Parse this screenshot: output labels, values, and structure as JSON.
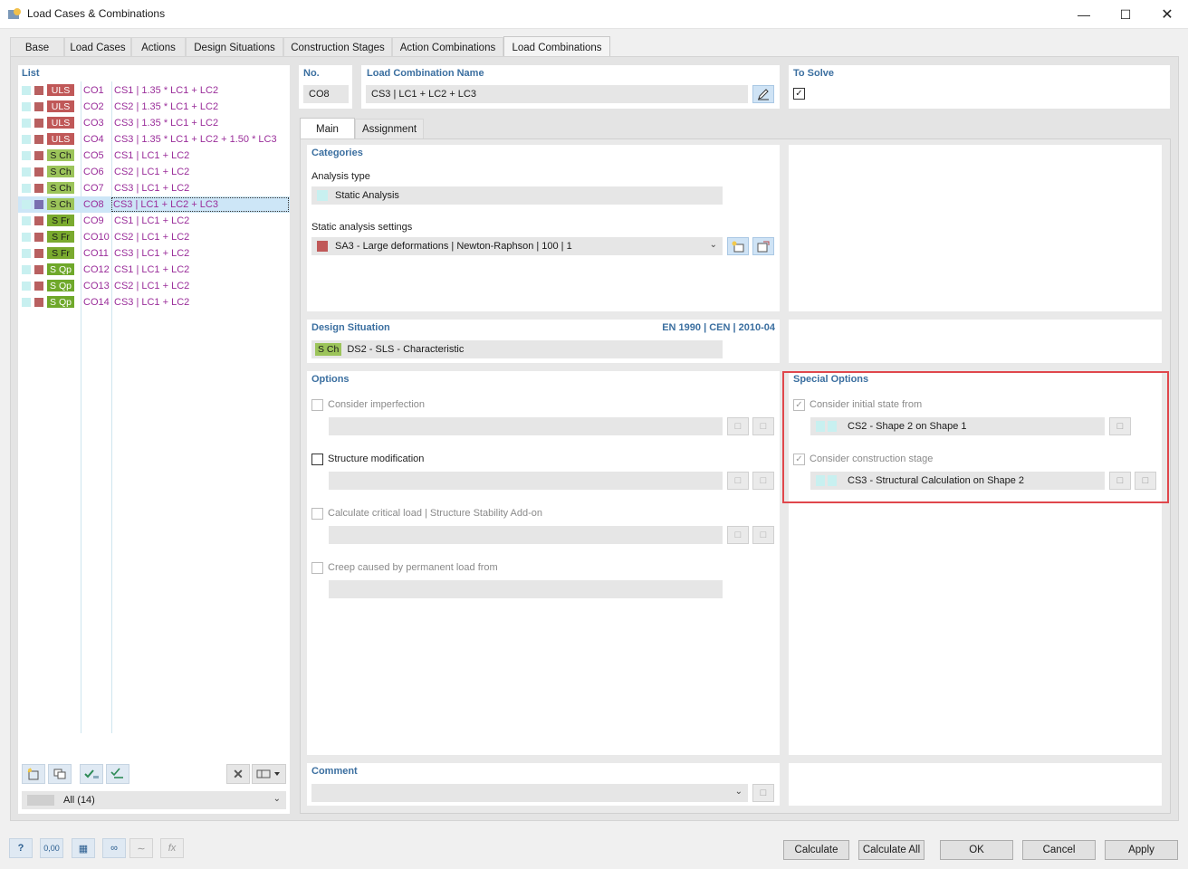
{
  "window": {
    "title": "Load Cases & Combinations"
  },
  "tabs": [
    "Base",
    "Load Cases",
    "Actions",
    "Design Situations",
    "Construction Stages",
    "Action Combinations",
    "Load Combinations"
  ],
  "list": {
    "header": "List",
    "filter": "All (14)",
    "items": [
      {
        "badge": "ULS",
        "code": "CO1",
        "desc": "CS1 | 1.35 * LC1 + LC2"
      },
      {
        "badge": "ULS",
        "code": "CO2",
        "desc": "CS2 | 1.35 * LC1 + LC2"
      },
      {
        "badge": "ULS",
        "code": "CO3",
        "desc": "CS3 | 1.35 * LC1 + LC2"
      },
      {
        "badge": "ULS",
        "code": "CO4",
        "desc": "CS3 | 1.35 * LC1 + LC2 + 1.50 * LC3"
      },
      {
        "badge": "S Ch",
        "code": "CO5",
        "desc": "CS1 | LC1 + LC2"
      },
      {
        "badge": "S Ch",
        "code": "CO6",
        "desc": "CS2 | LC1 + LC2"
      },
      {
        "badge": "S Ch",
        "code": "CO7",
        "desc": "CS3 | LC1 + LC2"
      },
      {
        "badge": "S Ch",
        "code": "CO8",
        "desc": "CS3 | LC1 + LC2 + LC3"
      },
      {
        "badge": "S Fr",
        "code": "CO9",
        "desc": "CS1 | LC1 + LC2"
      },
      {
        "badge": "S Fr",
        "code": "CO10",
        "desc": "CS2 | LC1 + LC2"
      },
      {
        "badge": "S Fr",
        "code": "CO11",
        "desc": "CS3 | LC1 + LC2"
      },
      {
        "badge": "S Qp",
        "code": "CO12",
        "desc": "CS1 | LC1 + LC2"
      },
      {
        "badge": "S Qp",
        "code": "CO13",
        "desc": "CS2 | LC1 + LC2"
      },
      {
        "badge": "S Qp",
        "code": "CO14",
        "desc": "CS3 | LC1 + LC2"
      }
    ]
  },
  "header": {
    "no_label": "No.",
    "no_value": "CO8",
    "name_label": "Load Combination Name",
    "name_value": "CS3 | LC1 + LC2 + LC3",
    "solve_label": "To Solve"
  },
  "subtabs": [
    "Main",
    "Assignment"
  ],
  "categories": {
    "header": "Categories",
    "analysis_type_label": "Analysis type",
    "analysis_type_value": "Static Analysis",
    "static_settings_label": "Static analysis settings",
    "static_settings_value": "SA3 - Large deformations | Newton-Raphson | 100 | 1"
  },
  "design_situation": {
    "header": "Design Situation",
    "standard": "EN 1990 | CEN | 2010-04",
    "badge": "S Ch",
    "value": "DS2 - SLS - Characteristic"
  },
  "options": {
    "header": "Options",
    "imperfection": "Consider imperfection",
    "structure_mod": "Structure modification",
    "critical_load": "Calculate critical load | Structure Stability Add-on",
    "creep": "Creep caused by permanent load from"
  },
  "special_options": {
    "header": "Special Options",
    "initial_state_label": "Consider initial state from",
    "initial_state_value": "CS2 - Shape 2 on Shape 1",
    "construction_stage_label": "Consider construction stage",
    "construction_stage_value": "CS3 - Structural Calculation on Shape 2"
  },
  "comment": {
    "header": "Comment"
  },
  "footer": {
    "zero_value": "0,00",
    "calculate": "Calculate",
    "calculate_all": "Calculate All",
    "ok": "OK",
    "cancel": "Cancel",
    "apply": "Apply"
  },
  "colors": {
    "uls": "#c05858",
    "sls_char": "#9cc45a",
    "header_blue": "#3b6fa0",
    "highlight_red": "#e0474c",
    "selection": "#cde6f7"
  }
}
